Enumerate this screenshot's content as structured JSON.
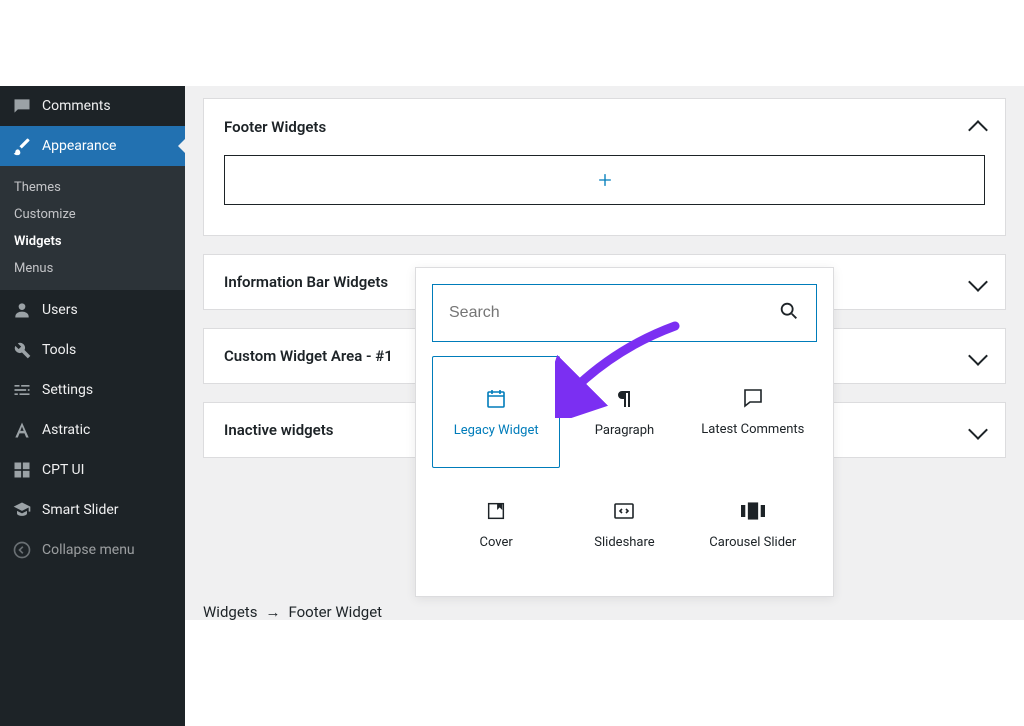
{
  "sidebar": {
    "primary": [
      {
        "id": "comments",
        "label": "Comments"
      },
      {
        "id": "appearance",
        "label": "Appearance",
        "active": true
      }
    ],
    "appearance_sub": [
      {
        "id": "themes",
        "label": "Themes"
      },
      {
        "id": "customize",
        "label": "Customize"
      },
      {
        "id": "widgets",
        "label": "Widgets",
        "current": true
      },
      {
        "id": "menus",
        "label": "Menus"
      }
    ],
    "secondary": [
      {
        "id": "users",
        "label": "Users"
      },
      {
        "id": "tools",
        "label": "Tools"
      },
      {
        "id": "settings",
        "label": "Settings"
      },
      {
        "id": "astratic",
        "label": "Astratic"
      },
      {
        "id": "cptui",
        "label": "CPT UI"
      },
      {
        "id": "smartslider",
        "label": "Smart Slider"
      },
      {
        "id": "collapse",
        "label": "Collapse menu"
      }
    ]
  },
  "panels": [
    {
      "id": "footer",
      "title": "Footer Widgets",
      "open": true
    },
    {
      "id": "info",
      "title": "Information Bar Widgets"
    },
    {
      "id": "custom",
      "title": "Custom Widget Area - #1"
    },
    {
      "id": "inactive",
      "title": "Inactive widgets"
    }
  ],
  "search": {
    "placeholder": "Search"
  },
  "blocks": [
    {
      "id": "legacy",
      "label": "Legacy Widget",
      "selected": true
    },
    {
      "id": "paragraph",
      "label": "Paragraph"
    },
    {
      "id": "latestcomments",
      "label": "Latest Comments"
    },
    {
      "id": "cover",
      "label": "Cover"
    },
    {
      "id": "slideshare",
      "label": "Slideshare"
    },
    {
      "id": "carousel",
      "label": "Carousel Slider"
    }
  ],
  "breadcrumb": {
    "root": "Widgets",
    "child": "Footer Widget"
  },
  "colors": {
    "accent": "#2271b1",
    "primaryBlue": "#007cba",
    "purple": "#7b2ff2"
  }
}
